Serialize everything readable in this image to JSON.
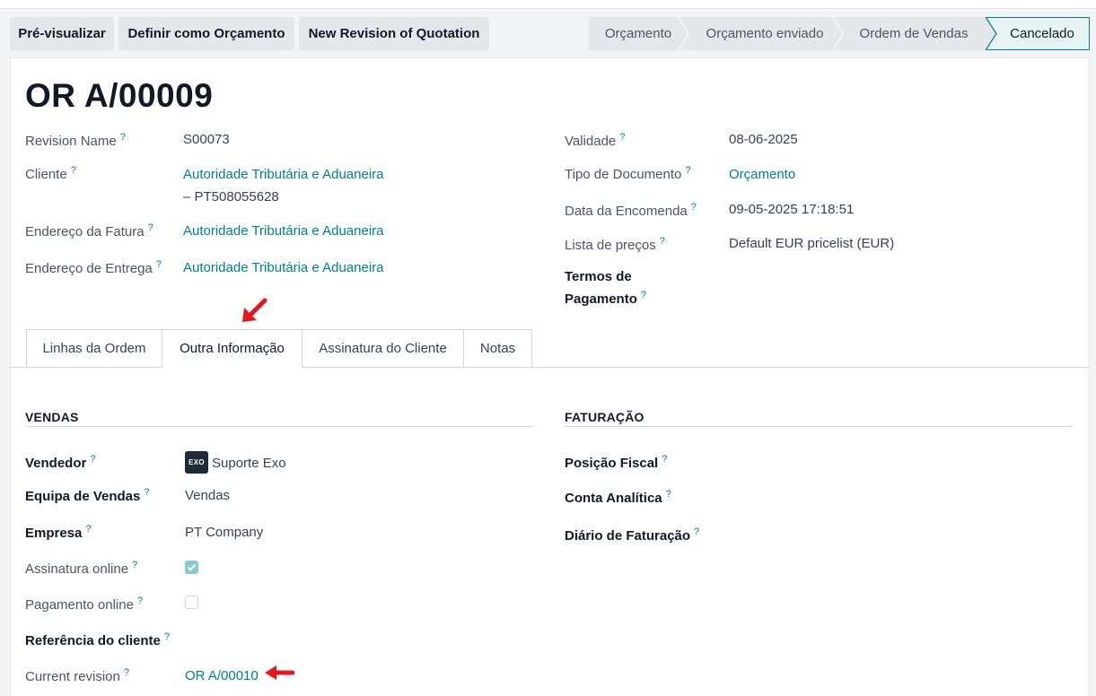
{
  "toolbar": {
    "preview_label": "Pré-visualizar",
    "set_quotation_label": "Definir como Orçamento",
    "new_revision_label": "New Revision of Quotation"
  },
  "statusbar": {
    "stages": [
      "Orçamento",
      "Orçamento enviado",
      "Ordem de Vendas",
      "Cancelado"
    ],
    "active": "Cancelado"
  },
  "record": {
    "title": "OR A/00009",
    "revision_name_label": "Revision Name",
    "revision_name": "S00073",
    "customer_label": "Cliente",
    "customer_line1": "Autoridade Tributária e Aduaneira",
    "customer_line2": "– PT508055628",
    "invoice_address_label": "Endereço da Fatura",
    "invoice_address": "Autoridade Tributária e Aduaneira",
    "delivery_address_label": "Endereço de Entrega",
    "delivery_address": "Autoridade Tributária e Aduaneira",
    "validity_label": "Validade",
    "validity": "08-06-2025",
    "doc_type_label": "Tipo de Documento",
    "doc_type": "Orçamento",
    "order_date_label": "Data da Encomenda",
    "order_date": "09-05-2025 17:18:51",
    "pricelist_label": "Lista de preços",
    "pricelist": "Default EUR pricelist (EUR)",
    "payment_terms_label_1": "Termos de",
    "payment_terms_label_2": "Pagamento"
  },
  "tabs": [
    "Linhas da Ordem",
    "Outra Informação",
    "Assinatura do Cliente",
    "Notas"
  ],
  "sales": {
    "header": "VENDAS",
    "salesperson_label": "Vendedor",
    "salesperson_avatar": "EXO",
    "salesperson": "Suporte Exo",
    "team_label": "Equipa de Vendas",
    "team": "Vendas",
    "company_label": "Empresa",
    "company": "PT Company",
    "online_signature_label": "Assinatura online",
    "online_signature": true,
    "online_payment_label": "Pagamento online",
    "online_payment": false,
    "client_ref_label": "Referência do cliente",
    "current_revision_label": "Current revision",
    "current_revision": "OR A/00010"
  },
  "invoicing": {
    "header": "FATURAÇÃO",
    "fiscal_position_label": "Posição Fiscal",
    "analytic_account_label": "Conta Analítica",
    "journal_label": "Diário de Faturação"
  },
  "help_mark": "?",
  "colors": {
    "accent": "#017e84",
    "annotation": "#e3171f"
  }
}
